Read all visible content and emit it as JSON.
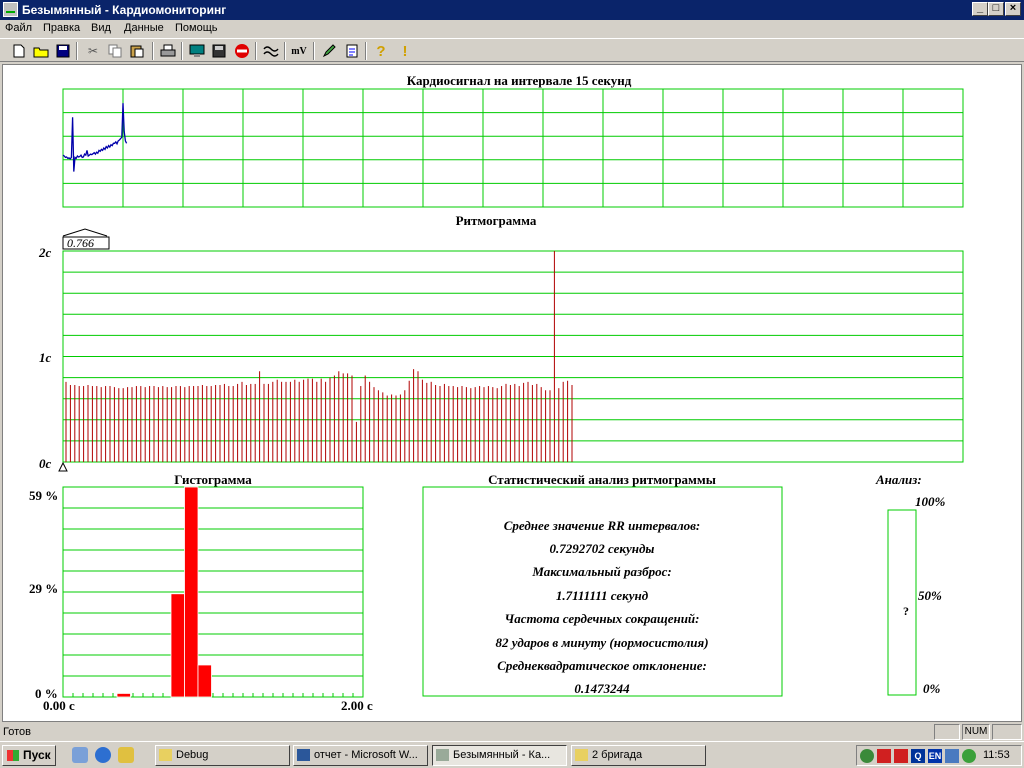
{
  "window": {
    "title": "Безымянный - Кардиомониторинг"
  },
  "menu": [
    "Файл",
    "Правка",
    "Вид",
    "Данные",
    "Помощь"
  ],
  "toolbar": {
    "icons": [
      "new-file-icon",
      "open-folder-icon",
      "save-icon",
      "cut-icon",
      "copy-icon",
      "paste-icon",
      "print-icon",
      "monitor-icon",
      "disk-icon",
      "stop-icon",
      "filter-wave-icon",
      "millivolt-icon",
      "pen-icon",
      "document-icon",
      "help-icon",
      "exclamation-icon"
    ],
    "mv_label": "mV"
  },
  "cardio": {
    "title": "Кардиосигнал на интервале 15 секунд"
  },
  "rhythm": {
    "title": "Ритмограмма",
    "marker_value": "0.766",
    "y_ticks": [
      "2c",
      "1c",
      "0c"
    ],
    "ylim": [
      0,
      2
    ]
  },
  "hist": {
    "title": "Гистограмма",
    "y_ticks": [
      "59 %",
      "29 %",
      "0 %"
    ],
    "x_ticks": [
      "0.00 с",
      "2.00 с"
    ]
  },
  "stats": {
    "title": "Статистический анализ ритмограммы",
    "lines": [
      "Среднее значение RR интервалов:",
      "0.7292702 секунды",
      "Максимальный разброс:",
      "1.7111111 секунд",
      "Частота сердечных сокращений:",
      "82 ударов в минуту (нормосистолия)",
      "Среднеквадратическое отклонение:",
      "0.1473244"
    ]
  },
  "analysis": {
    "title": "Анализ:",
    "value": "?",
    "scale": [
      "100%",
      "50%",
      "0%"
    ]
  },
  "status": {
    "text": "Готов",
    "num": "NUM"
  },
  "taskbar": {
    "start": "Пуск",
    "tasks": [
      "Debug",
      "отчет - Microsoft W...",
      "Безымянный - Ка...",
      "2 бригада"
    ],
    "tray_lang": "EN",
    "clock": "11:53"
  },
  "colors": {
    "grid": "#00cc00",
    "bars": "#b00000",
    "hist": "#ff0000",
    "signal": "#0000aa",
    "titlebar": "#0a246a"
  },
  "chart_data": [
    {
      "type": "line",
      "title": "Кардиосигнал на интервале 15 секунд",
      "x": [
        0,
        0.02,
        0.04,
        0.06,
        0.08,
        0.1,
        0.12,
        0.14,
        0.16,
        0.18,
        0.2,
        0.22,
        0.24,
        0.26,
        0.28,
        0.3,
        0.32,
        0.34,
        0.36,
        0.38,
        0.4,
        0.42,
        0.44,
        0.46,
        0.48,
        0.5,
        0.52,
        0.54,
        0.56,
        0.58,
        0.6,
        0.62,
        0.64,
        0.66,
        0.68,
        0.7,
        0.72,
        0.74,
        0.76,
        0.78,
        0.8,
        0.82,
        0.84,
        0.86,
        0.88,
        0.9,
        0.92,
        0.94,
        0.96,
        0.98,
        1.0,
        1.02,
        1.04,
        1.06
      ],
      "y": [
        0.1,
        0.08,
        0.05,
        0.06,
        0.03,
        0.04,
        0.02,
        0.05,
        0.9,
        -0.25,
        0.05,
        0.03,
        0.08,
        0.06,
        0.07,
        0.1,
        0.05,
        0.06,
        0.12,
        0.1,
        0.2,
        0.08,
        0.1,
        0.12,
        0.11,
        0.13,
        0.15,
        0.12,
        0.16,
        0.14,
        0.2,
        0.18,
        0.22,
        0.2,
        0.25,
        0.22,
        0.28,
        0.25,
        0.3,
        0.27,
        0.32,
        0.3,
        0.35,
        0.35,
        0.38,
        0.34,
        0.4,
        0.42,
        0.45,
        0.48,
        1.2,
        0.6,
        0.4,
        0.35
      ],
      "xlim": [
        0,
        15
      ],
      "ylim": [
        -1,
        1.5
      ],
      "grid": true
    },
    {
      "type": "bar",
      "title": "Ритмограмма",
      "values": [
        0.76,
        0.73,
        0.73,
        0.72,
        0.72,
        0.73,
        0.72,
        0.72,
        0.71,
        0.72,
        0.72,
        0.71,
        0.7,
        0.7,
        0.71,
        0.71,
        0.72,
        0.72,
        0.71,
        0.72,
        0.72,
        0.71,
        0.72,
        0.71,
        0.71,
        0.72,
        0.72,
        0.71,
        0.72,
        0.72,
        0.72,
        0.73,
        0.72,
        0.72,
        0.73,
        0.73,
        0.74,
        0.72,
        0.72,
        0.74,
        0.76,
        0.73,
        0.74,
        0.74,
        0.86,
        0.74,
        0.74,
        0.76,
        0.78,
        0.76,
        0.76,
        0.76,
        0.78,
        0.76,
        0.78,
        0.79,
        0.79,
        0.76,
        0.79,
        0.76,
        0.8,
        0.82,
        0.86,
        0.84,
        0.84,
        0.82,
        0.38,
        0.72,
        0.82,
        0.76,
        0.71,
        0.68,
        0.66,
        0.63,
        0.64,
        0.63,
        0.64,
        0.68,
        0.77,
        0.88,
        0.86,
        0.78,
        0.75,
        0.76,
        0.73,
        0.72,
        0.74,
        0.72,
        0.72,
        0.71,
        0.72,
        0.71,
        0.7,
        0.71,
        0.72,
        0.71,
        0.72,
        0.71,
        0.7,
        0.72,
        0.74,
        0.73,
        0.74,
        0.72,
        0.75,
        0.76,
        0.73,
        0.74,
        0.71,
        0.68,
        0.68,
        2.0,
        0.7,
        0.76,
        0.77,
        0.73
      ],
      "ylim": [
        0,
        2
      ],
      "grid": true
    },
    {
      "type": "bar",
      "title": "Гистограмма",
      "bins_start": [
        0.36,
        0.72,
        0.81
      ],
      "bin_width": 0.09,
      "values": [
        1,
        29,
        59,
        0
      ],
      "bins": [
        {
          "x0": 0.36,
          "x1": 0.45,
          "value": 1
        },
        {
          "x0": 0.72,
          "x1": 0.81,
          "value": 29
        },
        {
          "x0": 0.81,
          "x1": 0.9,
          "value": 59
        },
        {
          "x0": 0.9,
          "x1": 0.99,
          "value": 9
        }
      ],
      "xlim": [
        0,
        2
      ],
      "ylim": [
        0,
        59
      ],
      "grid": true
    }
  ]
}
